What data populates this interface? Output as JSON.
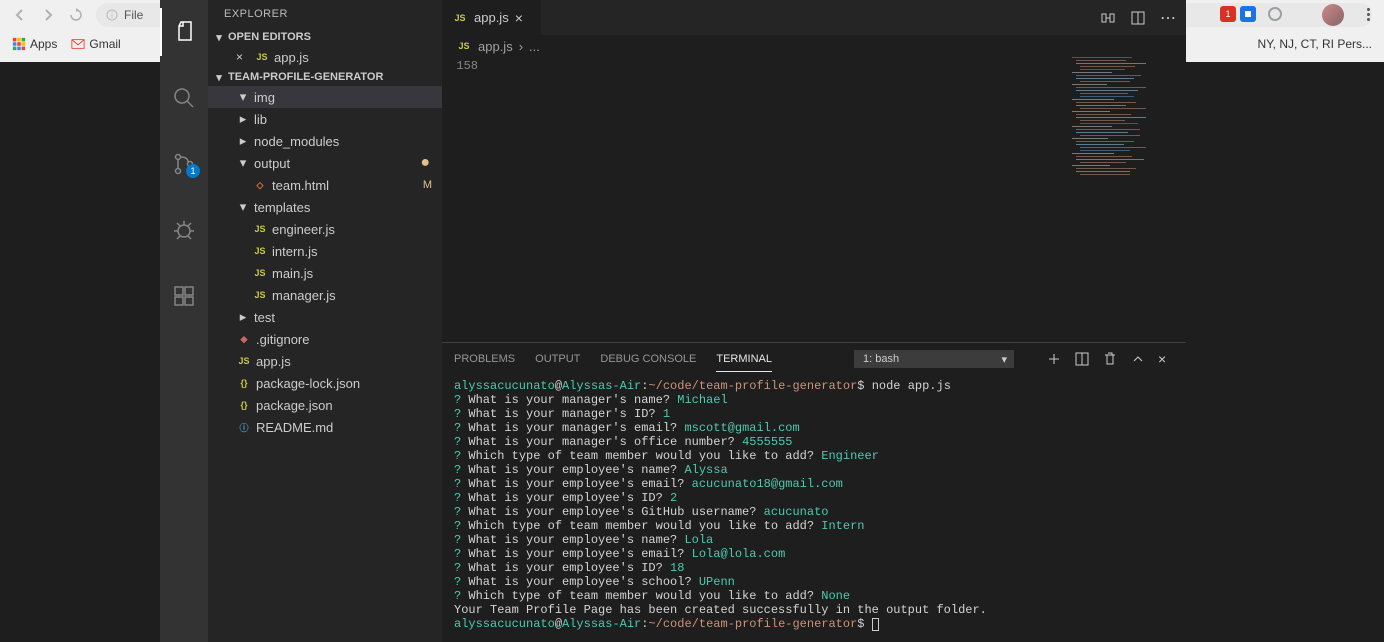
{
  "browser": {
    "url": "File",
    "bookmarks": [
      "Apps",
      "Gmail"
    ],
    "right_bookmark": "NY, NJ, CT, RI Pers..."
  },
  "recording_badge": "1",
  "activity_bar": {
    "scm_badge": "1"
  },
  "sidebar": {
    "title": "EXPLORER",
    "sections": {
      "open_editors": "OPEN EDITORS",
      "project": "TEAM-PROFILE-GENERATOR"
    },
    "open_editor_file": "app.js",
    "tree": {
      "img": "img",
      "lib": "lib",
      "node_modules": "node_modules",
      "output": "output",
      "team_html": "team.html",
      "team_html_mod": "M",
      "templates": "templates",
      "engineer_js": "engineer.js",
      "intern_js": "intern.js",
      "main_js": "main.js",
      "manager_js": "manager.js",
      "test": "test",
      "gitignore": ".gitignore",
      "app_js": "app.js",
      "package_lock": "package-lock.json",
      "package_json": "package.json",
      "readme": "README.md"
    }
  },
  "editor": {
    "tab_label": "app.js",
    "breadcrumb_file": "app.js",
    "breadcrumb_rest": "...",
    "line_number": "158"
  },
  "panel": {
    "tabs": {
      "problems": "PROBLEMS",
      "output": "OUTPUT",
      "debug": "DEBUG CONSOLE",
      "terminal": "TERMINAL"
    },
    "dropdown": "1: bash"
  },
  "terminal": {
    "prompt_user": "alyssacucunato",
    "prompt_at": "@",
    "prompt_host": "Alyssas-Air",
    "prompt_colon": ":",
    "prompt_path": "~/code/team-profile-generator",
    "prompt_dollar": "$",
    "cmd1": " node app.js",
    "lines": [
      {
        "q": "? ",
        "text": "What is your manager's name? ",
        "ans": "Michael",
        "cls": "t-green"
      },
      {
        "q": "? ",
        "text": "What is your manager's ID? ",
        "ans": "1",
        "cls": "t-green"
      },
      {
        "q": "? ",
        "text": "What is your manager's email? ",
        "ans": "mscott@gmail.com",
        "cls": "t-green"
      },
      {
        "q": "? ",
        "text": "What is your manager's office number? ",
        "ans": "4555555",
        "cls": "t-green"
      },
      {
        "q": "? ",
        "text": "Which type of team member would you like to add? ",
        "ans": "Engineer",
        "cls": "t-green"
      },
      {
        "q": "? ",
        "text": "What is your employee's name? ",
        "ans": "Alyssa",
        "cls": "t-green"
      },
      {
        "q": "? ",
        "text": "What is your employee's email? ",
        "ans": "acucunato18@gmail.com",
        "cls": "t-green"
      },
      {
        "q": "? ",
        "text": "What is your employee's ID? ",
        "ans": "2",
        "cls": "t-green"
      },
      {
        "q": "? ",
        "text": "What is your employee's GitHub username? ",
        "ans": "acucunato",
        "cls": "t-green"
      },
      {
        "q": "? ",
        "text": "Which type of team member would you like to add? ",
        "ans": "Intern",
        "cls": "t-green"
      },
      {
        "q": "? ",
        "text": "What is your employee's name? ",
        "ans": "Lola",
        "cls": "t-green"
      },
      {
        "q": "? ",
        "text": "What is your employee's email? ",
        "ans": "Lola@lola.com",
        "cls": "t-green"
      },
      {
        "q": "? ",
        "text": "What is your employee's ID? ",
        "ans": "18",
        "cls": "t-green"
      },
      {
        "q": "? ",
        "text": "What is your employee's school? ",
        "ans": "UPenn",
        "cls": "t-green"
      },
      {
        "q": "? ",
        "text": "Which type of team member would you like to add? ",
        "ans": "None",
        "cls": "t-green"
      }
    ],
    "success_msg": "Your Team Profile Page has been created successfully in the output folder."
  }
}
